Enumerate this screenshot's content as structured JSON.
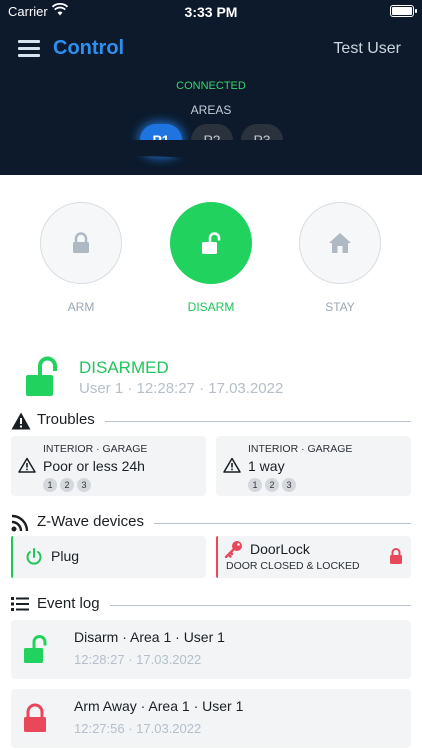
{
  "status_bar": {
    "carrier": "Carrier",
    "time": "3:33 PM"
  },
  "header": {
    "title": "Control",
    "user": "Test User",
    "connection": "CONNECTED",
    "areas_label": "AREAS",
    "areas": [
      {
        "label": "P1",
        "active": true
      },
      {
        "label": "P2",
        "active": false
      },
      {
        "label": "P3",
        "active": false
      }
    ]
  },
  "modes": [
    {
      "label": "ARM",
      "icon": "lock-icon",
      "active": false
    },
    {
      "label": "DISARM",
      "icon": "unlock-icon",
      "active": true
    },
    {
      "label": "STAY",
      "icon": "home-icon",
      "active": false
    }
  ],
  "status": {
    "state": "DISARMED",
    "detail": "User 1 · 12:28:27 · 17.03.2022",
    "color": "#21c55a"
  },
  "troubles": {
    "title": "Troubles",
    "items": [
      {
        "location": "INTERIOR · GARAGE",
        "text": "Poor or less 24h",
        "badges": [
          "1",
          "2",
          "3"
        ]
      },
      {
        "location": "INTERIOR · GARAGE",
        "text": "1 way",
        "badges": [
          "1",
          "2",
          "3"
        ]
      }
    ]
  },
  "zwave": {
    "title": "Z-Wave devices",
    "plug": {
      "name": "Plug",
      "icon": "power-icon",
      "color": "#21c55a"
    },
    "lock": {
      "name": "DoorLock",
      "state": "DOOR CLOSED & LOCKED",
      "icon": "key-icon",
      "color": "#e8485a"
    }
  },
  "event_log": {
    "title": "Event log",
    "events": [
      {
        "title": "Disarm · Area 1 · User 1",
        "time": "12:28:27 · 17.03.2022",
        "icon": "unlock-icon",
        "color": "#21c55a"
      },
      {
        "title": "Arm Away · Area 1 · User 1",
        "time": "12:27:56 · 17.03.2022",
        "icon": "lock-icon",
        "color": "#e8485a"
      }
    ]
  }
}
